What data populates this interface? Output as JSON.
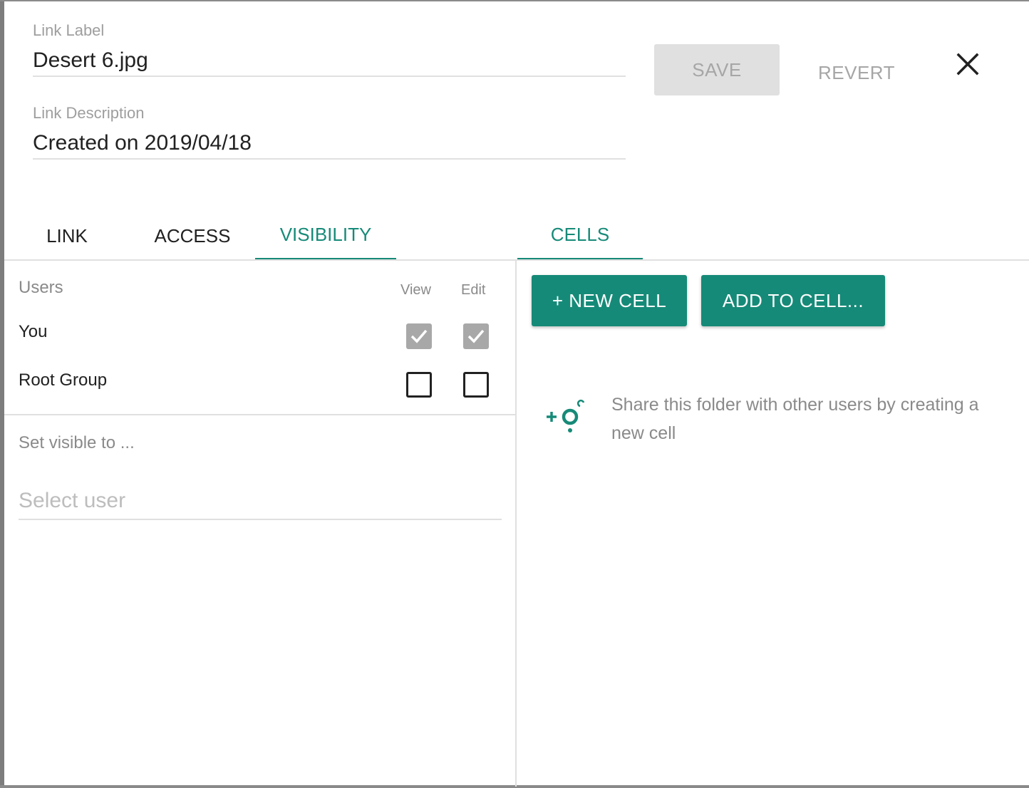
{
  "colors": {
    "accent": "#168a78",
    "muted_text": "#8a8a8a",
    "disabled_button": "#e0e0e0",
    "checked_disabled": "#a8a8a8"
  },
  "header": {
    "label_field": {
      "label": "Link Label",
      "value": "Desert 6.jpg"
    },
    "description_field": {
      "label": "Link Description",
      "value": "Created on 2019/04/18"
    },
    "save_label": "SAVE",
    "revert_label": "REVERT",
    "close_icon": "close-icon"
  },
  "tabs": {
    "left": [
      {
        "label": "LINK",
        "active": false
      },
      {
        "label": "ACCESS",
        "active": false
      },
      {
        "label": "VISIBILITY",
        "active": true
      }
    ],
    "right": [
      {
        "label": "CELLS",
        "active": true
      }
    ]
  },
  "visibility": {
    "users_heading": "Users",
    "col_view": "View",
    "col_edit": "Edit",
    "users": [
      {
        "name": "You",
        "view": true,
        "edit": true,
        "disabled": true
      },
      {
        "name": "Root Group",
        "view": false,
        "edit": false,
        "disabled": false
      }
    ],
    "set_visible_label": "Set visible to ...",
    "select_user_placeholder": "Select user"
  },
  "cells": {
    "new_cell_label": "+ NEW CELL",
    "add_to_cell_label": "ADD TO CELL...",
    "empty_icon": "add-cell-icon",
    "empty_message": "Share this folder with other users by creating a new cell"
  }
}
